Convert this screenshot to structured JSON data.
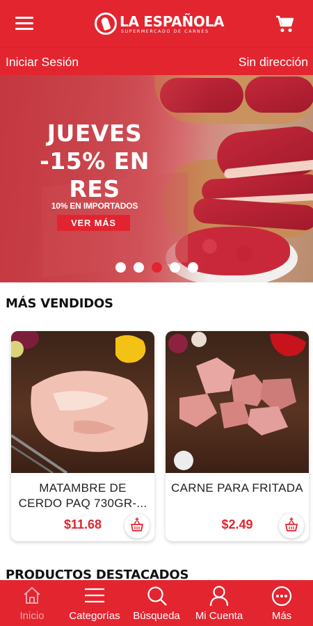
{
  "header": {
    "menu_icon": "hamburger-icon",
    "brand_name": "LA ESPAÑOLA",
    "brand_tagline": "SUPERMERCADO DE CARNES",
    "cart_icon": "cart-icon"
  },
  "session_bar": {
    "login_label": "Iniciar Sesión",
    "address_label": "Sin dirección"
  },
  "banner": {
    "title_line1": "JUEVES",
    "title_line2": "-15% EN",
    "title_line3": "RES",
    "subtitle": "10% EN IMPORTADOS",
    "button_label": "VER MÁS",
    "dots_count": 5,
    "active_dot": 3
  },
  "best_sellers": {
    "title": "MÁS VENDIDOS",
    "products": [
      {
        "name": "MATAMBRE DE CERDO PAQ 730GR-...",
        "price": "$11.68",
        "add_icon": "basket-add-icon"
      },
      {
        "name": "CARNE PARA FRITADA",
        "price": "$2.49",
        "add_icon": "basket-add-icon"
      }
    ]
  },
  "featured": {
    "title": "PRODUCTOS DESTACADOS"
  },
  "bottom_nav": {
    "items": [
      {
        "label": "Inicio",
        "icon": "home-icon",
        "active": true
      },
      {
        "label": "Categorías",
        "icon": "list-icon",
        "active": false
      },
      {
        "label": "Búsqueda",
        "icon": "search-icon",
        "active": false
      },
      {
        "label": "Mi Cuenta",
        "icon": "user-icon",
        "active": false
      },
      {
        "label": "Más",
        "icon": "more-icon",
        "active": false
      }
    ]
  },
  "colors": {
    "brand_red": "#e32530",
    "price_red": "#e3242f",
    "active_nav_label": "#f0a6aa"
  }
}
